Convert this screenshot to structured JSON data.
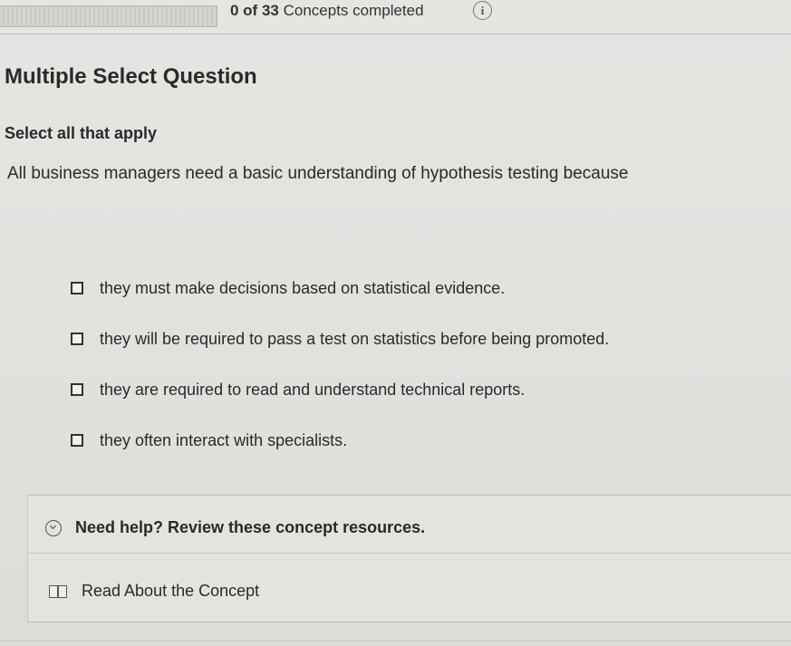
{
  "progress": {
    "count": "0 of 33",
    "label": "Concepts completed",
    "completed_fraction": 0,
    "info_icon": "i"
  },
  "question": {
    "type_label": "Multiple Select Question",
    "instruction": "Select all that apply",
    "prompt": "All business managers need a basic understanding of hypothesis testing because",
    "options": [
      {
        "label": "they must make decisions based on statistical evidence.",
        "checked": false
      },
      {
        "label": "they will be required to pass a test on statistics before being promoted.",
        "checked": false
      },
      {
        "label": "they are required to read and understand technical reports.",
        "checked": false
      },
      {
        "label": "they often interact with specialists.",
        "checked": false
      }
    ]
  },
  "help": {
    "title": "Need help? Review these concept resources.",
    "toggle_icon": "chevron-down-icon",
    "resources": [
      {
        "label": "Read About the Concept",
        "icon": "book-icon"
      }
    ]
  },
  "colors": {
    "background": "#e4e3e0",
    "text": "#2a2a2a",
    "progress_fill": "#3d7bd6"
  }
}
